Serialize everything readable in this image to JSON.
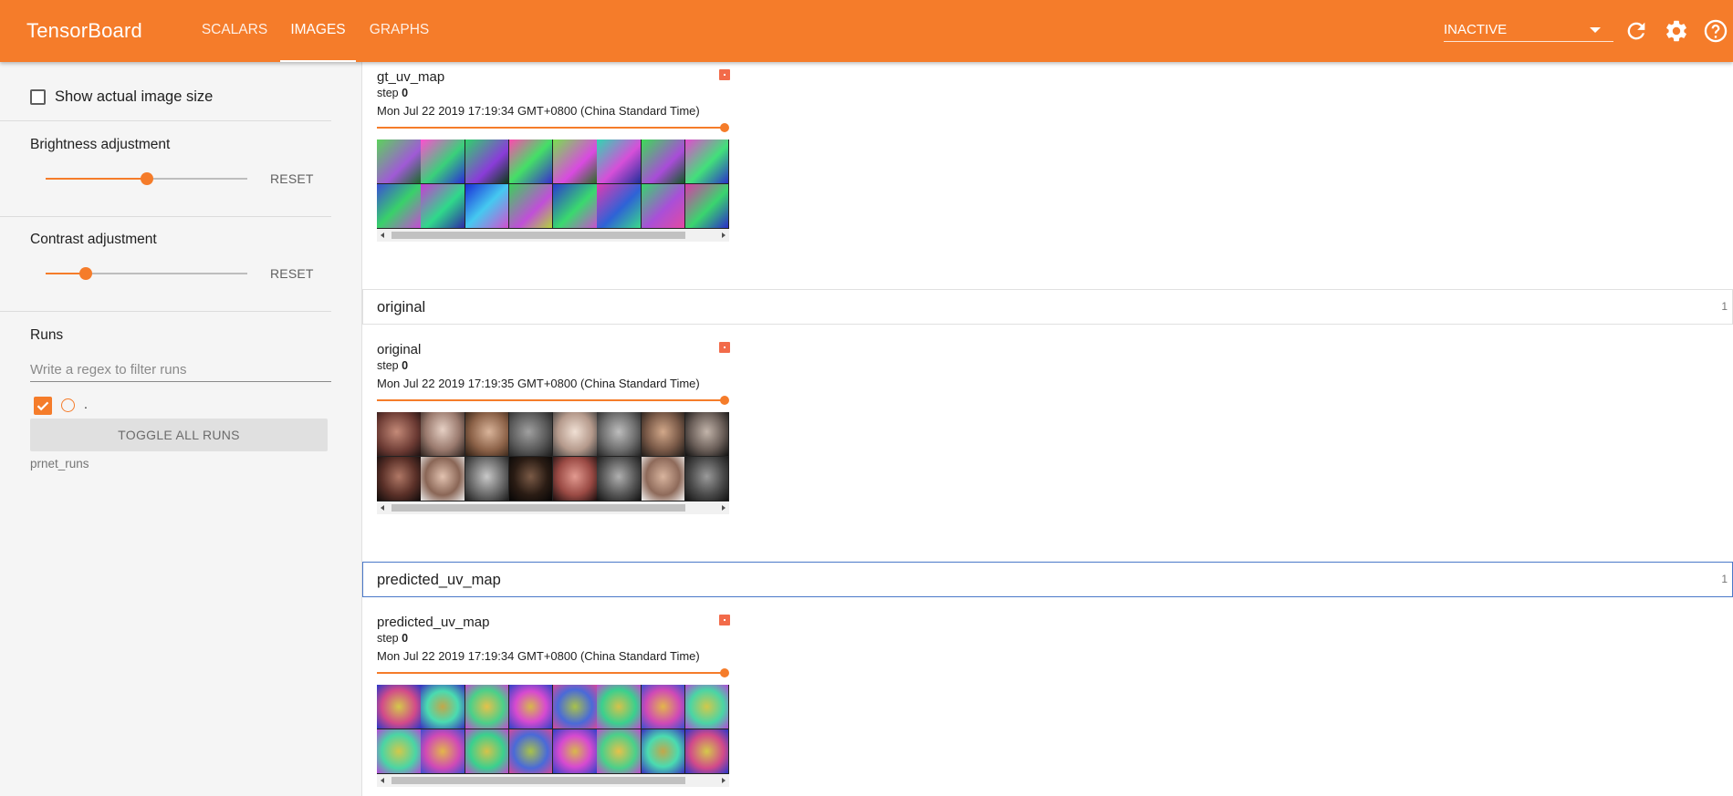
{
  "app": {
    "title": "TensorBoard"
  },
  "nav": {
    "tabs": [
      {
        "label": "SCALARS",
        "active": false
      },
      {
        "label": "IMAGES",
        "active": true
      },
      {
        "label": "GRAPHS",
        "active": false
      }
    ],
    "dashboard_select": {
      "value": "INACTIVE"
    },
    "icons": [
      "refresh-icon",
      "settings-icon",
      "help-icon"
    ]
  },
  "sidebar": {
    "show_actual_size": {
      "label": "Show actual image size",
      "checked": false
    },
    "brightness": {
      "title": "Brightness adjustment",
      "level": 0.5,
      "reset_label": "RESET"
    },
    "contrast": {
      "title": "Contrast adjustment",
      "level": 0.2,
      "reset_label": "RESET"
    },
    "runs": {
      "title": "Runs",
      "filter_placeholder": "Write a regex to filter runs",
      "run_items": [
        {
          "name": ".",
          "checked": true
        }
      ],
      "toggle_all_label": "TOGGLE ALL RUNS",
      "logdir": "prnet_runs"
    }
  },
  "main": {
    "cards": [
      {
        "title": "gt_uv_map",
        "step_label": "step",
        "step": "0",
        "timestamp": "Mon Jul 22 2019 17:19:34 GMT+0800 (China Standard Time)",
        "kind": "uv"
      },
      {
        "title": "original",
        "step_label": "step",
        "step": "0",
        "timestamp": "Mon Jul 22 2019 17:19:35 GMT+0800 (China Standard Time)",
        "kind": "faces"
      },
      {
        "title": "predicted_uv_map",
        "step_label": "step",
        "step": "0",
        "timestamp": "Mon Jul 22 2019 17:19:34 GMT+0800 (China Standard Time)",
        "kind": "uv_pred"
      }
    ],
    "groups": [
      {
        "name": "original",
        "count": "1"
      },
      {
        "name": "predicted_uv_map",
        "count": "1"
      }
    ]
  },
  "colors": {
    "accent": "#f57c2a",
    "focus": "#4a78c8",
    "expand_button": "#f26b4a"
  }
}
